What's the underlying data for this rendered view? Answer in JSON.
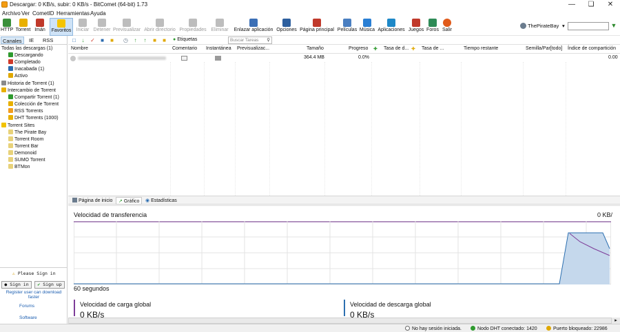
{
  "window": {
    "title": "Descargar: 0 KB/s, subir: 0 KB/s - BitComet (64-bit) 1.73"
  },
  "menu": [
    "Archivo",
    "Ver",
    "CometID",
    "Herramientas",
    "Ayuda"
  ],
  "toolbar": {
    "http": "HTTP",
    "torrent": "Torrent",
    "iman": "Imán",
    "favoritos": "Favoritos",
    "iniciar": "Iniciar",
    "detener": "Detener",
    "previsualizar": "Previsualizar",
    "abrir_directorio": "Abrir directorio",
    "propiedades": "Propiedades",
    "eliminar": "Eliminar",
    "enlazar": "Enlazar aplicación",
    "opciones": "Opciones",
    "pagina_principal": "Página principal",
    "peliculas": "Películas",
    "musica": "Música",
    "aplicaciones": "Aplicaciones",
    "juegos": "Juegos",
    "foros": "Foros",
    "salir": "Salir",
    "site_select": "ThePirateBay"
  },
  "sidebar": {
    "tabs": [
      "Canales",
      "IE",
      "RSS"
    ],
    "tree": {
      "todas": "Todas las descargas (1)",
      "descargando": "Descargando",
      "completado": "Completado",
      "inacabada": "Inacabada (1)",
      "activo": "Activo",
      "historia": "Historia de Torrent (1)",
      "intercambio": "Intercambio de Torrent",
      "compartir": "Compartir Torrent (1)",
      "coleccion": "Colección de Torrent",
      "rss": "RSS Torrents",
      "dht": "DHT Torrents (1000)",
      "sites": "Torrent Sites",
      "tpb": "The Pirate Bay",
      "room": "Torrent Room",
      "bar": "Torrent Bar",
      "demonoid": "Demonoid",
      "sumo": "SUMO Torrent",
      "btmon": "BTMon"
    },
    "please_sign_in": "Please Sign in",
    "sign_in": "Sign in",
    "sign_up": "Sign up",
    "register_line1": "Register user can download",
    "register_line2": "faster",
    "forums": "Forums",
    "software": "Software"
  },
  "tasks_toolbar": {
    "etiquetas": "Etiquetas",
    "search_placeholder": "Buscar Tareas"
  },
  "columns": [
    "Nombre",
    "Comentario",
    "Instantánea",
    "Previsualizac...",
    "Tamaño",
    "Progreso",
    "Tasa de d...",
    "Tasa de ...",
    "Tiempo restante",
    "Semilla/Par[todo]",
    "Índice de compartición"
  ],
  "task": {
    "size": "364.4 MB",
    "progress": "0.0%",
    "share_ratio": "0.00"
  },
  "bottom_tabs": [
    "Página de inicio",
    "Gráfico",
    "Estadísticas"
  ],
  "graph": {
    "title": "Velocidad de transferencia",
    "right_value": "0 KB/",
    "x_label": "60 segundos",
    "upload_label": "Velocidad de carga global",
    "upload_value": "0 KB/s",
    "download_label": "Velocidad de descarga global",
    "download_value": "0 KB/s"
  },
  "status": {
    "session": "No hay sesión iniciada.",
    "dht": "Nodo DHT conectado: 1420",
    "port": "Puerto bloqueado: 22986"
  },
  "colors": {
    "accent": "#7d3c98",
    "download_line": "#2c6fb0",
    "ok": "#2e9a2e",
    "warn": "#e0a800"
  }
}
